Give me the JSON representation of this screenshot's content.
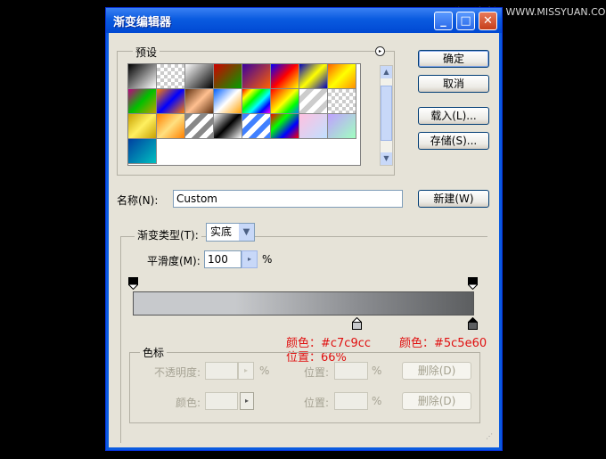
{
  "watermark": "思缘设计论坛 WWW.MISSYUAN.COM",
  "window": {
    "title": "渐变编辑器"
  },
  "titlebar_buttons": {
    "minimize": "_",
    "maximize": "□",
    "close": "✕"
  },
  "presets": {
    "label": "预设",
    "menu_icon": "▸",
    "scroll_up": "▲",
    "scroll_down": "▼",
    "swatches": [
      "linear-gradient(135deg,#000,#fff)",
      "repeating-conic-gradient(#ccc 0 25%,#fff 0 50%) 0 0/8px 8px",
      "linear-gradient(135deg,#fff,#000)",
      "linear-gradient(135deg,#d00000,#00a000)",
      "linear-gradient(135deg,#3a00a0,#ff6000)",
      "linear-gradient(135deg,#0000ff,#ff0000,#ffff00)",
      "linear-gradient(135deg,#0000c0,#ffff00,#0000c0)",
      "linear-gradient(135deg,#ff6000,#ffff00,#ff9000)",
      "linear-gradient(135deg,#c00080,#00c000,#c0a000)",
      "linear-gradient(135deg,#ff8000,#0000ff,#ff8000)",
      "linear-gradient(135deg,#603010,#ffc090,#603010)",
      "linear-gradient(135deg,#0060ff,#ffffff 50%,#ffa000)",
      "linear-gradient(135deg,#ff0000,#ffff00,#00ff00,#00ffff,#0000ff,#ff00ff)",
      "linear-gradient(135deg,#ff0000,#ff8000,#ffff00,#00ff00,#0080ff)",
      "repeating-linear-gradient(135deg,#fff 0 6px,#ccc 6px 12px)",
      "repeating-conic-gradient(#ccc 0 25%,#fff 0 50%) 0 0/8px 8px",
      "linear-gradient(135deg,#c8a000,#fff060,#c8a000)",
      "linear-gradient(135deg,#ff8000,#ffe080,#ff8000)",
      "repeating-linear-gradient(135deg,#888 0 6px,#fff 6px 12px)",
      "linear-gradient(135deg,#fff,#000 50%,#fff)",
      "repeating-linear-gradient(135deg,#4080ff 0 6px,#fff 6px 12px)",
      "linear-gradient(135deg,#ff0000,#00ff00,#0000ff,#ff0000)",
      "linear-gradient(135deg,#ffc0e0,#c0e0ff)",
      "linear-gradient(135deg,#c0a0ff,#a0ffc0)",
      "linear-gradient(135deg,#0040a0,#00c0c0)"
    ]
  },
  "buttons": {
    "ok": "确定",
    "cancel": "取消",
    "load": "载入(L)...",
    "save": "存储(S)...",
    "new": "新建(W)"
  },
  "name_field": {
    "label": "名称(N):",
    "value": "Custom"
  },
  "gradient_group": {
    "type_label": "渐变类型(T):",
    "type_value": "实底",
    "smoothness_label": "平滑度(M):",
    "smoothness_value": "100",
    "smoothness_unit": "%",
    "dropdown_arrow": "▼",
    "spin_arrow": "▸"
  },
  "gradient": {
    "start_color": "#c7c9cc",
    "end_color": "#5c5e60",
    "midstop_location_percent": 66
  },
  "annotations": {
    "stop1_color": "颜色：#c7c9cc",
    "stop1_position": "位置：66%",
    "stop2_color": "颜色：#5c5e60"
  },
  "stops_group": {
    "label": "色标",
    "opacity_label": "不透明度:",
    "opacity_unit": "%",
    "location_label_1": "位置:",
    "location_unit_1": "%",
    "delete_1": "删除(D)",
    "color_label": "颜色:",
    "location_label_2": "位置:",
    "location_unit_2": "%",
    "delete_2": "删除(D)"
  },
  "grip_glyph": "⋰"
}
